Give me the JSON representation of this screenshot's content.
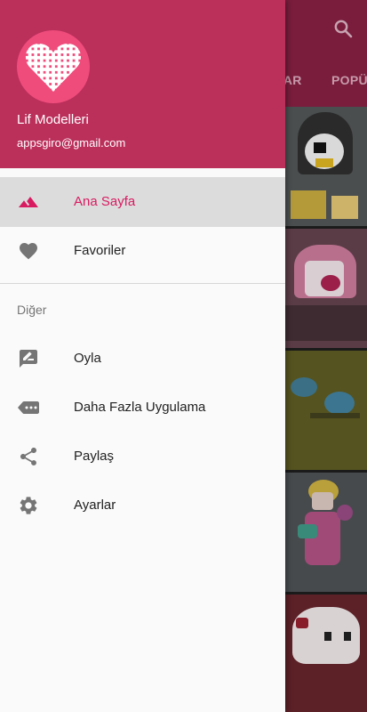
{
  "background_app": {
    "tabs": [
      "LAR",
      "POPÜ"
    ],
    "search_icon": "search-icon"
  },
  "drawer": {
    "header": {
      "app_name": "Lif Modelleri",
      "email": "appsgiro@gmail.com",
      "logo_icon": "heart-logo-icon"
    },
    "primary_items": [
      {
        "label": "Ana Sayfa",
        "icon": "landscape-icon",
        "active": true
      },
      {
        "label": "Favoriler",
        "icon": "heart-icon",
        "active": false
      }
    ],
    "section_title": "Diğer",
    "secondary_items": [
      {
        "label": "Oyla",
        "icon": "rate-review-icon"
      },
      {
        "label": "Daha Fazla Uygulama",
        "icon": "more-apps-icon"
      },
      {
        "label": "Paylaş",
        "icon": "share-icon"
      },
      {
        "label": "Ayarlar",
        "icon": "settings-icon"
      }
    ]
  },
  "colors": {
    "header_bg": "#bb2f5b",
    "avatar_bg": "#ef4c7b",
    "accent": "#d81b60",
    "active_row_bg": "#dcdcdc",
    "icon_gray": "#757575"
  }
}
